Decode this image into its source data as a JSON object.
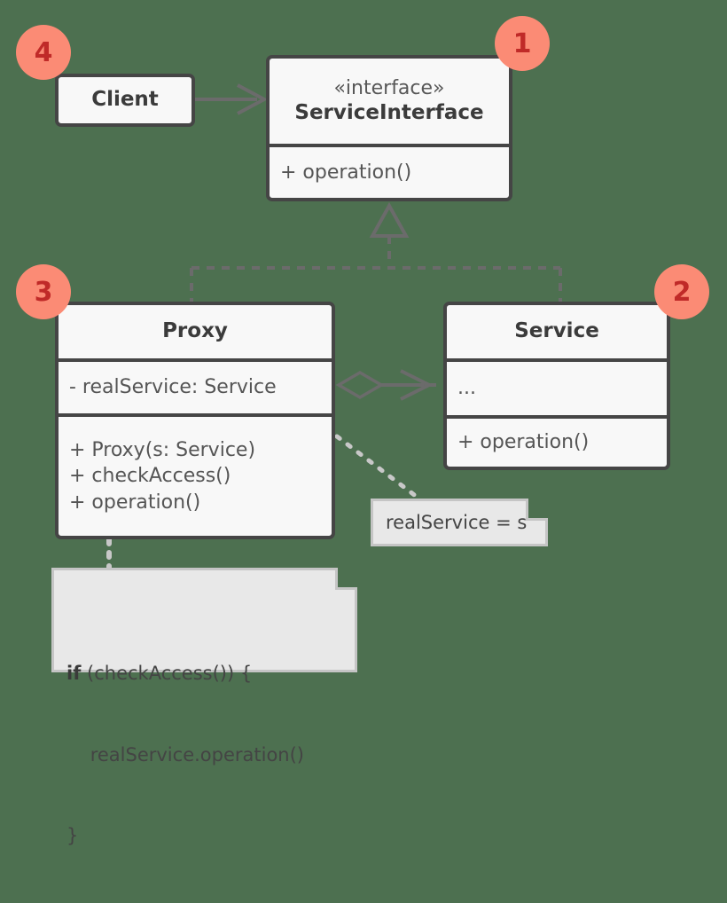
{
  "diagram": {
    "title": "Proxy design pattern UML class diagram",
    "background_color": "#4d7050",
    "box_fill": "#f8f8f8",
    "box_stroke": "#454545",
    "note_fill": "#e8e8e8",
    "note_stroke": "#c5c5c5",
    "badge_fill": "#fb8b75",
    "badge_text_color": "#c02a28",
    "connector_color": "#6b6b6b"
  },
  "classes": {
    "client": {
      "name": "Client",
      "stereotype": "",
      "attributes": [],
      "operations": []
    },
    "service_interface": {
      "stereotype": "«interface»",
      "name": "ServiceInterface",
      "attributes": [],
      "operations": [
        "+ operation()"
      ]
    },
    "proxy": {
      "name": "Proxy",
      "stereotype": "",
      "attributes": [
        "- realService: Service"
      ],
      "operations": [
        "+ Proxy(s: Service)",
        "+ checkAccess()",
        "+ operation()"
      ]
    },
    "service": {
      "name": "Service",
      "stereotype": "",
      "attributes": [
        "..."
      ],
      "operations": [
        "+ operation()"
      ]
    }
  },
  "notes": {
    "assignment": {
      "text": "realService = s"
    },
    "code": {
      "line1_keyword": "if",
      "line1_rest": " (checkAccess()) {",
      "line2": "    realService.operation()",
      "line3": "}"
    }
  },
  "badges": [
    {
      "number": "1",
      "target": "ServiceInterface"
    },
    {
      "number": "2",
      "target": "Service"
    },
    {
      "number": "3",
      "target": "Proxy"
    },
    {
      "number": "4",
      "target": "Client"
    }
  ],
  "connectors": [
    {
      "kind": "association-arrow",
      "from": "Client",
      "to": "ServiceInterface",
      "style": "solid"
    },
    {
      "kind": "realization",
      "from": "Proxy",
      "to": "ServiceInterface",
      "style": "dashed",
      "head": "hollow-triangle"
    },
    {
      "kind": "realization",
      "from": "Service",
      "to": "ServiceInterface",
      "style": "dashed",
      "head": "hollow-triangle"
    },
    {
      "kind": "aggregation",
      "from": "Proxy",
      "to": "Service",
      "style": "solid",
      "tail": "hollow-diamond",
      "head": "open-arrow"
    },
    {
      "kind": "note-link",
      "from": "Proxy",
      "to": "realService = s",
      "style": "dotted"
    },
    {
      "kind": "note-link",
      "from": "Proxy",
      "to": "code-note",
      "style": "dotted"
    }
  ]
}
